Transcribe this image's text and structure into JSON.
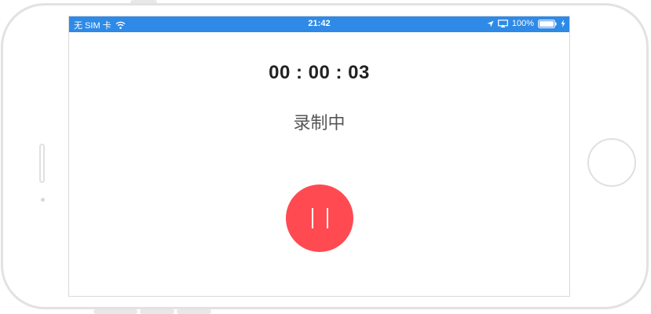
{
  "status_bar": {
    "carrier": "无 SIM 卡",
    "time": "21:42",
    "battery_percent": "100%",
    "background_color": "#2e8ae6",
    "icons": [
      "wifi-icon",
      "location-icon",
      "airplay-icon",
      "battery-icon",
      "charging-bolt-icon"
    ]
  },
  "recorder": {
    "elapsed_time": "00 : 00 : 03",
    "state_label": "录制中",
    "pause_button_icon": "pause-icon",
    "pause_button_color": "#ff4a52"
  }
}
